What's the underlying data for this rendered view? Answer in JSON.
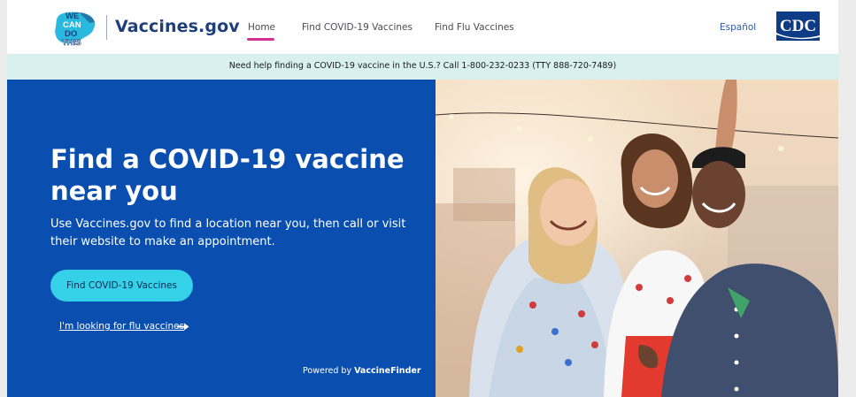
{
  "nav": {
    "brand": "Vaccines.gov",
    "logo_text": [
      "WE",
      "CAN",
      "DO",
      "THIS"
    ],
    "links": [
      {
        "label": "Home",
        "active": true
      },
      {
        "label": "Find COVID-19 Vaccines",
        "active": false
      },
      {
        "label": "Find Flu Vaccines",
        "active": false
      }
    ],
    "language": "Español",
    "agency_logo": "CDC"
  },
  "banner": {
    "text": "Need help finding a COVID-19 vaccine in the U.S.? Call 1-800-232-0233 (TTY 888-720-7489)"
  },
  "hero": {
    "title": "Find a COVID-19 vaccine near you",
    "body": "Use Vaccines.gov to find a location near you, then call or visit their website to make an appointment.",
    "cta_label": "Find COVID-19 Vaccines",
    "flu_link_label": "I'm looking for flu vaccines",
    "powered_prefix": "Powered by",
    "powered_brand": "VaccineFinder"
  },
  "colors": {
    "hero_bg": "#0a4fb0",
    "banner_bg": "#d8f0f0",
    "cta_bg": "#35d1e8",
    "active_underline": "#d2318f",
    "brand_text": "#1f3f7a"
  },
  "icons": [
    "we-can-do-this-logo",
    "cdc-logo",
    "arrow-right-icon"
  ]
}
